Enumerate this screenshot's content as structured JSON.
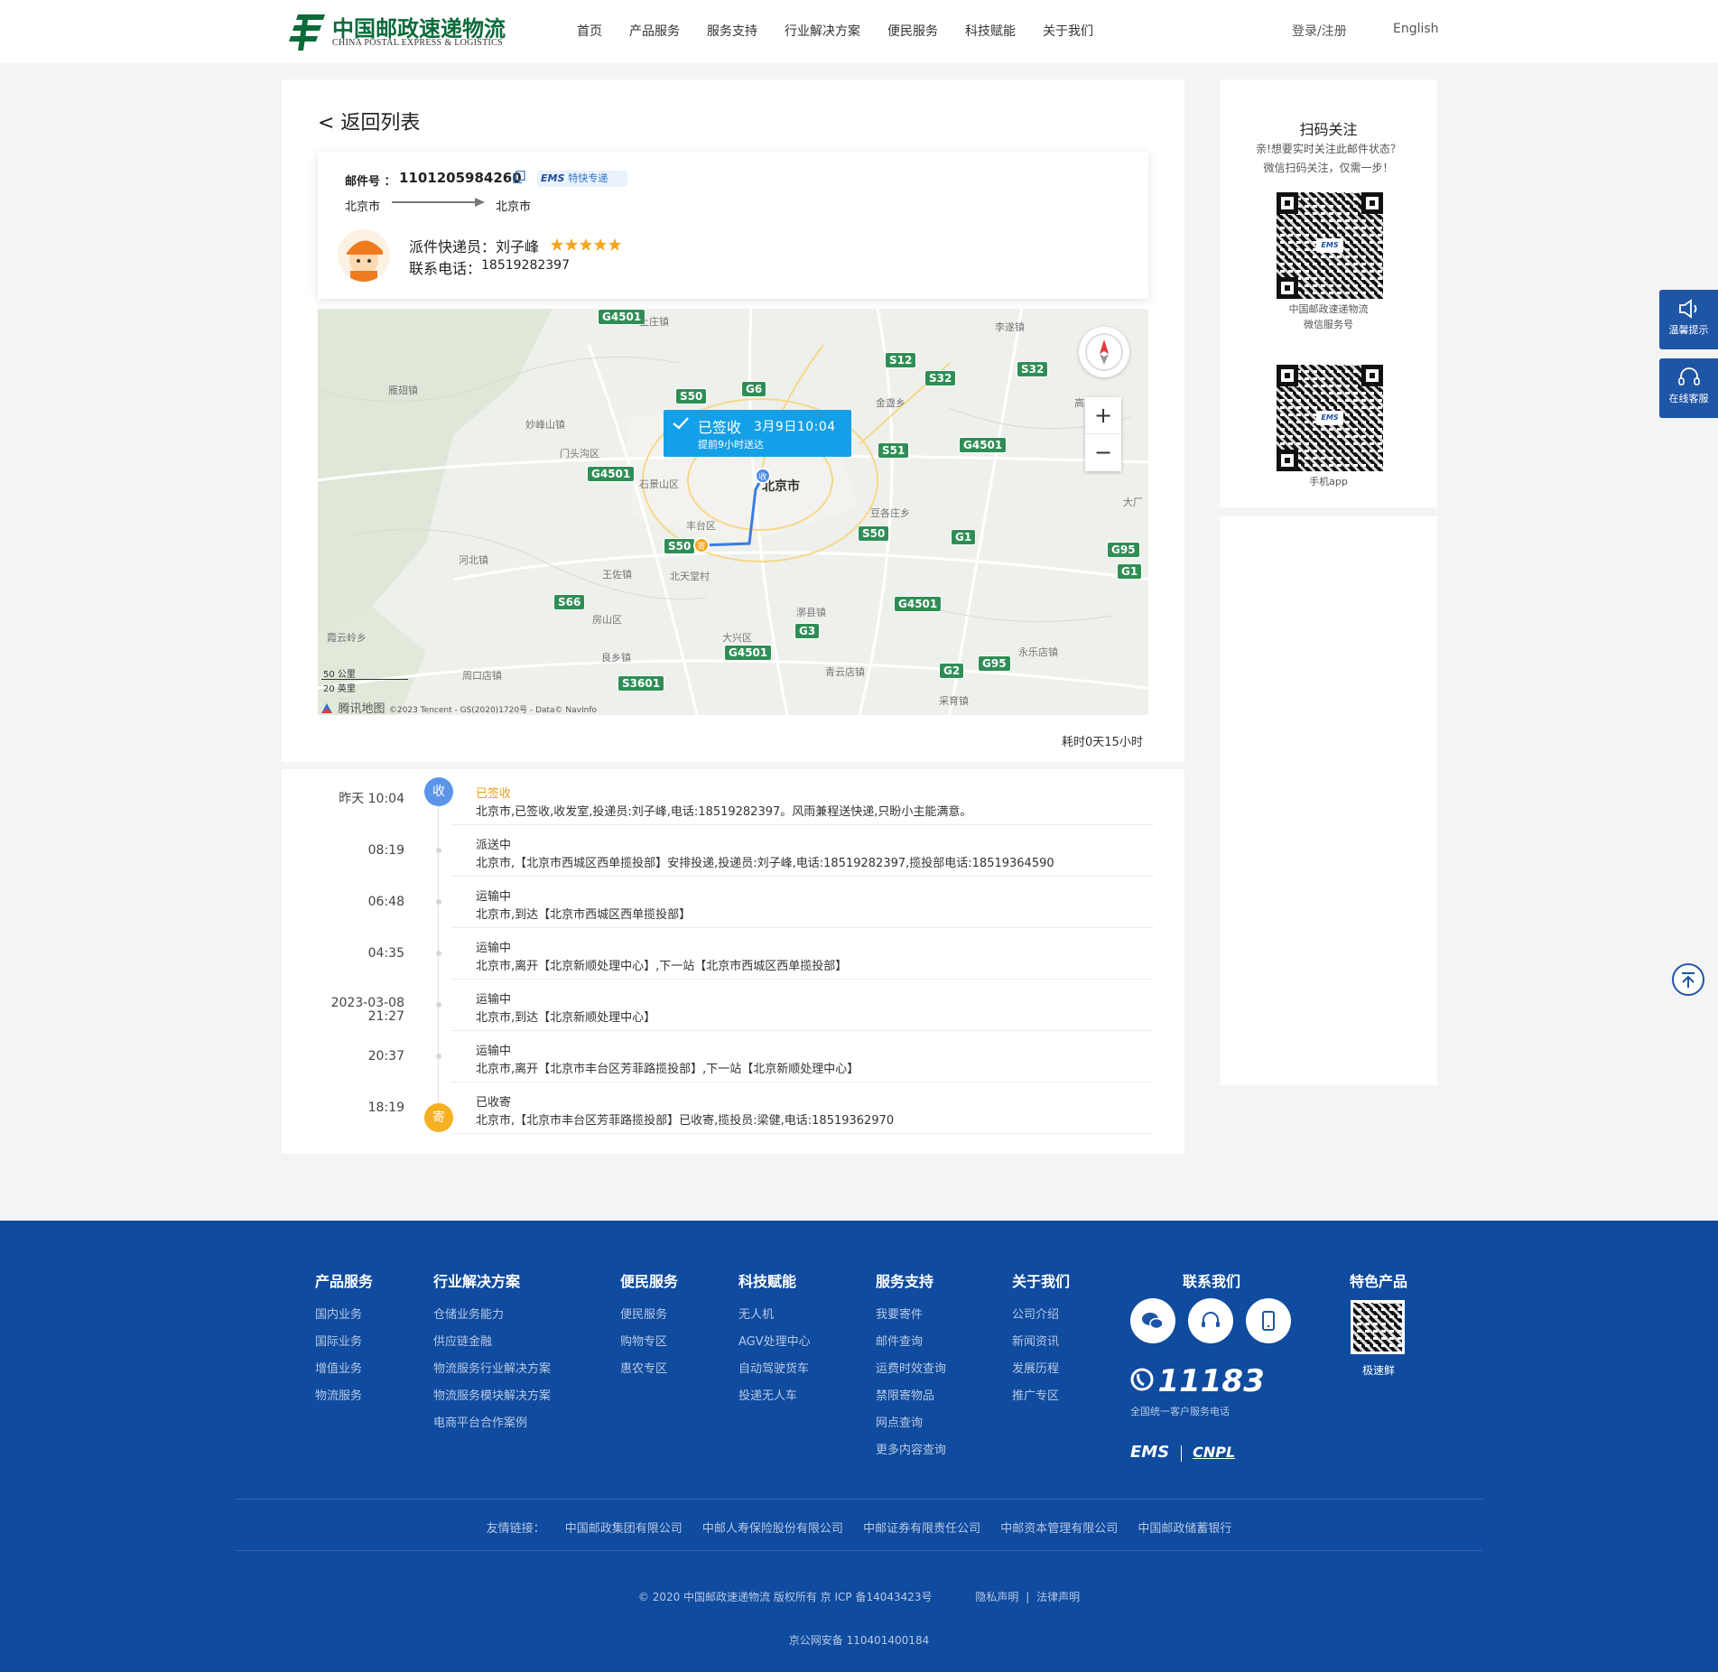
{
  "header": {
    "logo_cn": "中国邮政速递物流",
    "logo_en": "CHINA POSTAL EXPRESS & LOGISTICS",
    "nav": [
      "首页",
      "产品服务",
      "服务支持",
      "行业解决方案",
      "便民服务",
      "科技赋能",
      "关于我们"
    ],
    "login": "登录/注册",
    "language": "English"
  },
  "tracking": {
    "back": "< 返回列表",
    "mail_no_label": "邮件号 ：",
    "mail_no": "1101205984260",
    "service_logo": "EMS",
    "service_name": "特快专递",
    "origin": "北京市",
    "destination": "北京市",
    "courier_label": "派件快递员：刘子峰",
    "rating": 5,
    "phone_label": "联系电话：",
    "phone": "18519282397",
    "elapsed": "耗时0天15小时"
  },
  "map": {
    "status": "已签收",
    "status_time": "3月9日10:04",
    "status_sub": "提前9小时送达",
    "city": "北京市",
    "highways": [
      "G4501",
      "S12",
      "S32",
      "S32",
      "G6",
      "S50",
      "S51",
      "G4501",
      "G4501",
      "S50",
      "S50",
      "G1",
      "G95",
      "G1",
      "S66",
      "G4501",
      "G3",
      "G4501",
      "G2",
      "G95",
      "S3601"
    ],
    "places": [
      "上庄镇",
      "李遂镇",
      "雁翅镇",
      "妙峰山镇",
      "金盏乡",
      "门头沟区",
      "石景山区",
      "高",
      "大厂",
      "丰台区",
      "豆各庄乡",
      "河北镇",
      "王佐镇",
      "北天堂村",
      "漷县镇",
      "房山区",
      "大兴区",
      "霞云岭乡",
      "良乡镇",
      "青云店镇",
      "永乐店镇",
      "周口店镇",
      "采育镇"
    ],
    "scale_km": "50 公里",
    "scale_mi": "20 英里",
    "brand": "腾讯地图",
    "copyright": "©2023 Tencent - GS(2020)1720号 - Data© NavInfo",
    "pin_receive": "收",
    "pin_send": "寄"
  },
  "timeline": [
    {
      "time": "昨天 10:04",
      "status": "已签收",
      "detail": "北京市,已签收,收发室,投递员:刘子峰,电话:18519282397。风雨兼程送快递,只盼小主能满意。"
    },
    {
      "time": "08:19",
      "status": "派送中",
      "detail": "北京市,【北京市西城区西单揽投部】安排投递,投递员:刘子峰,电话:18519282397,揽投部电话:18519364590"
    },
    {
      "time": "06:48",
      "status": "运输中",
      "detail": "北京市,到达【北京市西城区西单揽投部】"
    },
    {
      "time": "04:35",
      "status": "运输中",
      "detail": "北京市,离开【北京新顺处理中心】,下一站【北京市西城区西单揽投部】"
    },
    {
      "time_date": "2023-03-08",
      "time": "21:27",
      "status": "运输中",
      "detail": "北京市,到达【北京新顺处理中心】"
    },
    {
      "time": "20:37",
      "status": "运输中",
      "detail": "北京市,离开【北京市丰台区芳菲路揽投部】,下一站【北京新顺处理中心】"
    },
    {
      "time": "18:19",
      "status": "已收寄",
      "detail": "北京市,【北京市丰台区芳菲路揽投部】已收寄,揽投员:梁健,电话:18519362970"
    }
  ],
  "timeline_badges": {
    "first": "收",
    "last": "寄"
  },
  "sidebar": {
    "title": "扫码关注",
    "desc1": "亲!想要实时关注此邮件状态？",
    "desc2": "微信扫码关注，仅需一步！",
    "qr1_caption1": "中国邮政速递物流",
    "qr1_caption2": "微信服务号",
    "qr2_caption": "手机app",
    "qr_logo": "EMS"
  },
  "float": {
    "tip": "温馨提示",
    "service": "在线客服"
  },
  "footer": {
    "columns": [
      {
        "title": "产品服务",
        "links": [
          "国内业务",
          "国际业务",
          "增值业务",
          "物流服务"
        ]
      },
      {
        "title": "行业解决方案",
        "links": [
          "仓储业务能力",
          "供应链金融",
          "物流服务行业解决方案",
          "物流服务模块解决方案",
          "电商平台合作案例"
        ]
      },
      {
        "title": "便民服务",
        "links": [
          "便民服务",
          "购物专区",
          "惠农专区"
        ]
      },
      {
        "title": "科技赋能",
        "links": [
          "无人机",
          "AGV处理中心",
          "自动驾驶货车",
          "投递无人车"
        ]
      },
      {
        "title": "服务支持",
        "links": [
          "我要寄件",
          "邮件查询",
          "运费时效查询",
          "禁限寄物品",
          "网点查询",
          "更多内容查询"
        ]
      },
      {
        "title": "关于我们",
        "links": [
          "公司介绍",
          "新闻资讯",
          "发展历程",
          "推广专区"
        ]
      }
    ],
    "contact_title": "联系我们",
    "hotline": "11183",
    "hotline_desc": "全国统一客户服务电话",
    "brand_ems": "EMS",
    "brand_cnpl": "CNPL",
    "special_title": "特色产品",
    "special_caption": "极速鲜",
    "friend_label": "友情链接：",
    "friends": [
      "中国邮政集团有限公司",
      "中邮人寿保险股份有限公司",
      "中邮证券有限责任公司",
      "中邮资本管理有限公司",
      "中国邮政储蓄银行"
    ],
    "copyright": "© 2020 中国邮政速递物流 版权所有 京 ICP 备14043423号",
    "privacy": "隐私声明",
    "legal": "法律声明",
    "beian": "京公网安备 110401400184"
  },
  "colors": {
    "brand_green": "#0b6b3a",
    "footer_blue": "#0f4b9e",
    "accent_orange": "#e97d1f",
    "status_orange": "#e8a023",
    "tooltip_blue": "#14a0e8"
  }
}
